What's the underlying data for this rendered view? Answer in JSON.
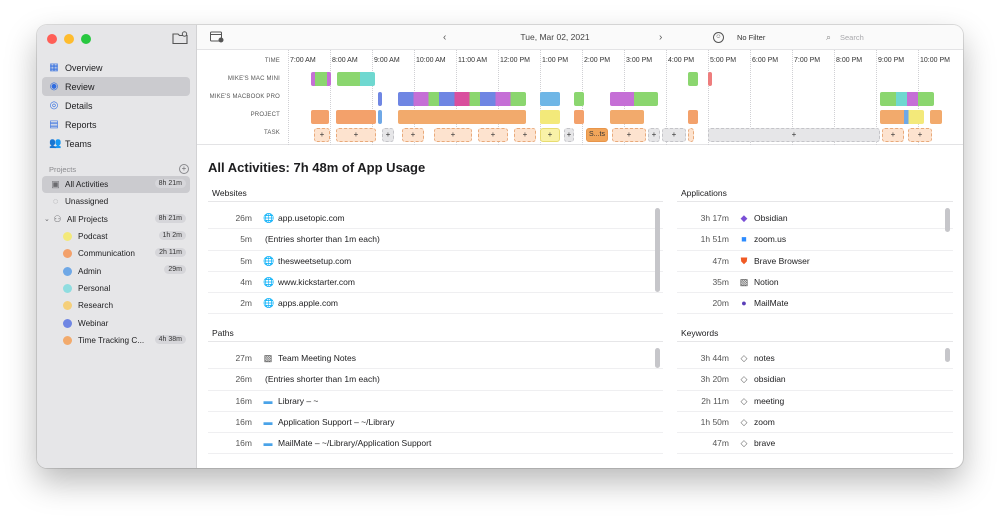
{
  "sidebar": {
    "nav": [
      {
        "label": "Overview",
        "icon": "grid-icon"
      },
      {
        "label": "Review",
        "icon": "check-circle-icon",
        "active": true
      },
      {
        "label": "Details",
        "icon": "eye-icon"
      },
      {
        "label": "Reports",
        "icon": "report-icon"
      },
      {
        "label": "Teams",
        "icon": "people-icon"
      }
    ],
    "projects_header": "Projects",
    "projects": [
      {
        "label": "All Activities",
        "badge": "8h 21m",
        "active": true
      },
      {
        "label": "Unassigned"
      },
      {
        "label": "All Projects",
        "badge": "8h 21m"
      },
      {
        "label": "Podcast",
        "badge": "1h 2m",
        "color": "#f3e97a"
      },
      {
        "label": "Communication",
        "badge": "2h 11m",
        "color": "#f3a16b"
      },
      {
        "label": "Admin",
        "badge": "29m",
        "color": "#6fa8e6"
      },
      {
        "label": "Personal",
        "color": "#8fdde0"
      },
      {
        "label": "Research",
        "color": "#f5cf7a"
      },
      {
        "label": "Webinar",
        "color": "#6f86e3"
      },
      {
        "label": "Time Tracking C...",
        "badge": "4h 38m",
        "color": "#f2aa6c"
      }
    ]
  },
  "toolbar": {
    "date": "Tue, Mar 02, 2021",
    "filter": "No Filter",
    "search_placeholder": "Search"
  },
  "timeline": {
    "rows": [
      "TIME",
      "MIKE'S MAC MINI",
      "MIKE'S MACBOOK PRO",
      "PROJECT",
      "TASK"
    ],
    "hours": [
      "7:00 AM",
      "8:00 AM",
      "9:00 AM",
      "10:00 AM",
      "11:00 AM",
      "12:00 PM",
      "1:00 PM",
      "2:00 PM",
      "3:00 PM",
      "4:00 PM",
      "5:00 PM",
      "6:00 PM",
      "7:00 PM",
      "8:00 PM",
      "9:00 PM",
      "10:00 PM"
    ],
    "task_label": "S...ts",
    "task_plus": "+"
  },
  "main": {
    "title": "All Activities: 7h 48m of App Usage",
    "websites": {
      "title": "Websites",
      "rows": [
        {
          "dur": "26m",
          "name": "app.usetopic.com",
          "icon": "globe-icon"
        },
        {
          "dur": "5m",
          "name": "(Entries shorter than 1m each)",
          "icon": ""
        },
        {
          "dur": "5m",
          "name": "thesweetsetup.com",
          "icon": "globe-icon"
        },
        {
          "dur": "4m",
          "name": "www.kickstarter.com",
          "icon": "globe-icon"
        },
        {
          "dur": "2m",
          "name": "apps.apple.com",
          "icon": "globe-icon"
        }
      ]
    },
    "applications": {
      "title": "Applications",
      "rows": [
        {
          "dur": "3h 17m",
          "name": "Obsidian",
          "icon": "obsidian-icon"
        },
        {
          "dur": "1h 51m",
          "name": "zoom.us",
          "icon": "zoom-icon"
        },
        {
          "dur": "47m",
          "name": "Brave Browser",
          "icon": "brave-icon"
        },
        {
          "dur": "35m",
          "name": "Notion",
          "icon": "notion-icon"
        },
        {
          "dur": "20m",
          "name": "MailMate",
          "icon": "mailmate-icon"
        }
      ]
    },
    "paths": {
      "title": "Paths",
      "rows": [
        {
          "dur": "27m",
          "name": "Team Meeting Notes",
          "icon": "notion-icon"
        },
        {
          "dur": "26m",
          "name": "(Entries shorter than 1m each)",
          "icon": ""
        },
        {
          "dur": "16m",
          "name": "Library – ~",
          "icon": "folder-icon"
        },
        {
          "dur": "16m",
          "name": "Application Support – ~/Library",
          "icon": "folder-icon"
        },
        {
          "dur": "16m",
          "name": "MailMate – ~/Library/Application Support",
          "icon": "folder-icon"
        }
      ]
    },
    "keywords": {
      "title": "Keywords",
      "rows": [
        {
          "dur": "3h 44m",
          "name": "notes",
          "icon": "tag-icon"
        },
        {
          "dur": "3h 20m",
          "name": "obsidian",
          "icon": "tag-icon"
        },
        {
          "dur": "2h 11m",
          "name": "meeting",
          "icon": "tag-icon"
        },
        {
          "dur": "1h 50m",
          "name": "zoom",
          "icon": "tag-icon"
        },
        {
          "dur": "47m",
          "name": "brave",
          "icon": "tag-icon"
        }
      ]
    }
  }
}
